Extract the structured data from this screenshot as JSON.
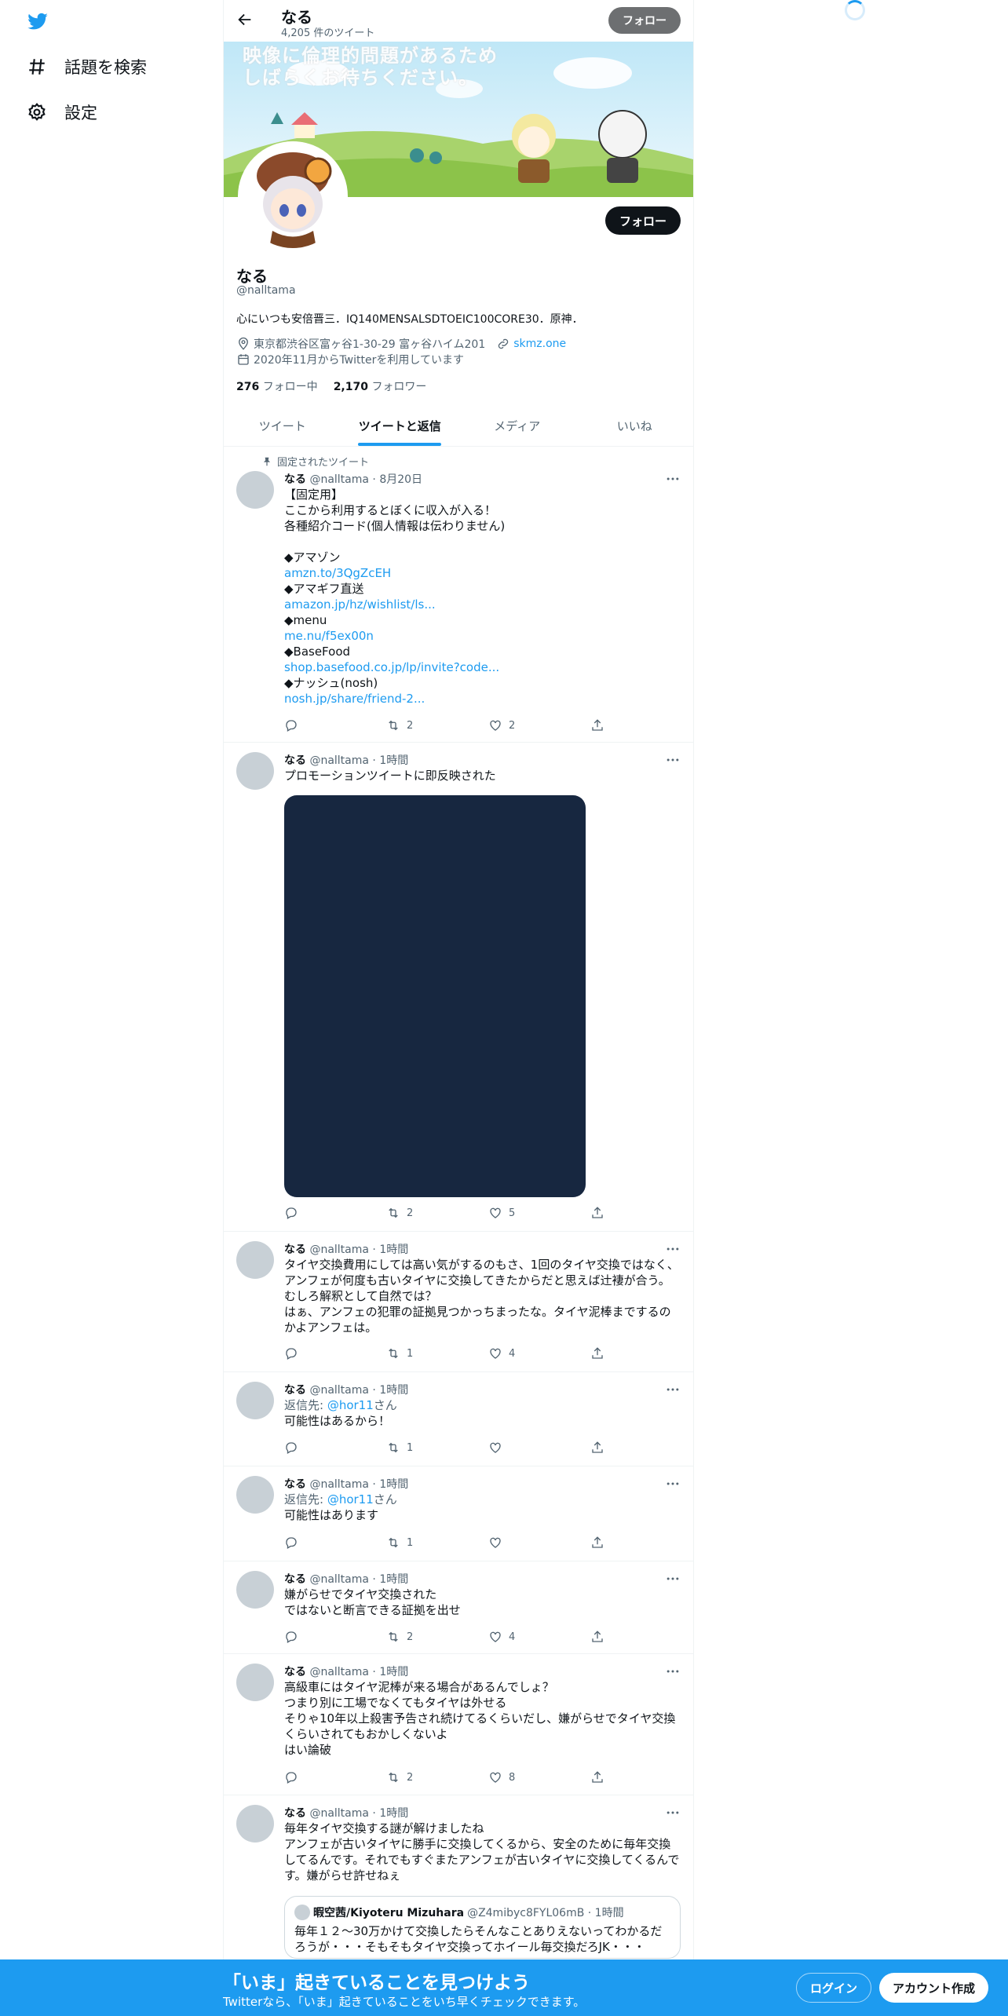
{
  "nav": {
    "explore_label": "話題を検索",
    "settings_label": "設定"
  },
  "topbar": {
    "name": "なる",
    "tweet_count": "4,205 件のツイート",
    "follow_label": "フォロー"
  },
  "banner": {
    "text_line1": "映像に倫理的問題があるため",
    "text_line2": "しばらくお待ちください。"
  },
  "profile": {
    "follow_label": "フォロー",
    "name": "なる",
    "handle": "@nalltama",
    "bio": "心にいつも安倍晋三．IQ140MENSALSDTOEIC100CORE30．原神．",
    "location": "東京都渋谷区富ヶ谷1-30-29 富ヶ谷ハイム201",
    "website": "skmz.one",
    "joined": "2020年11月からTwitterを利用しています",
    "following_count": "276",
    "following_label": "フォロー中",
    "followers_count": "2,170",
    "followers_label": "フォロワー"
  },
  "tabs": [
    {
      "label": "ツイート"
    },
    {
      "label": "ツイートと返信"
    },
    {
      "label": "メディア"
    },
    {
      "label": "いいね"
    }
  ],
  "tweets": [
    {
      "pinned_label": "固定されたツイート",
      "name": "なる",
      "meta": "@nalltama · 8月20日",
      "text_lines": [
        "【固定用】",
        "ここから利用するとぼくに収入が入る！",
        "各種紹介コード(個人情報は伝わりません)",
        "",
        "◆アマゾン"
      ],
      "link1": "amzn.to/3QgZcEH",
      "line2": "◆アマギフ直送",
      "link2": "amazon.jp/hz/wishlist/ls...",
      "line3": "◆menu",
      "link3": "me.nu/f5ex00n",
      "line4": "◆BaseFood",
      "link4": "shop.basefood.co.jp/lp/invite?code...",
      "line5": "◆ナッシュ(nosh)",
      "link5": "nosh.jp/share/friend-2...",
      "retweets": "2",
      "likes": "2"
    },
    {
      "name": "なる",
      "meta": "@nalltama · 1時間",
      "text": "プロモーションツイートに即反映された",
      "retweets": "2",
      "likes": "5"
    },
    {
      "name": "なる",
      "meta": "@nalltama · 1時間",
      "text": "タイヤ交換費用にしては高い気がするのもさ、1回のタイヤ交換ではなく、アンフェが何度も古いタイヤに交換してきたからだと思えば辻褄が合う。むしろ解釈として自然では？\nはぁ、アンフェの犯罪の証拠見つかっちまったな。タイヤ泥棒までするのかよアンフェは。",
      "retweets": "1",
      "likes": "4"
    },
    {
      "name": "なる",
      "meta": "@nalltama · 1時間",
      "reply_prefix": "返信先: ",
      "reply_handle": "@hor11",
      "reply_suffix": "さん",
      "text": "可能性はあるから！",
      "retweets": "1",
      "likes": ""
    },
    {
      "name": "なる",
      "meta": "@nalltama · 1時間",
      "reply_prefix": "返信先: ",
      "reply_handle": "@hor11",
      "reply_suffix": "さん",
      "text": "可能性はあります",
      "retweets": "1",
      "likes": ""
    },
    {
      "name": "なる",
      "meta": "@nalltama · 1時間",
      "text": "嫌がらせでタイヤ交換された\nではないと断言できる証拠を出せ",
      "retweets": "2",
      "likes": "4"
    },
    {
      "name": "なる",
      "meta": "@nalltama · 1時間",
      "text": "高級車にはタイヤ泥棒が来る場合があるんでしょ？\nつまり別に工場でなくてもタイヤは外せる\nそりゃ10年以上殺害予告され続けてるくらいだし、嫌がらせでタイヤ交換くらいされてもおかしくないよ\nはい論破",
      "retweets": "2",
      "likes": "8"
    },
    {
      "name": "なる",
      "meta": "@nalltama · 1時間",
      "text": "毎年タイヤ交換する謎が解けましたね\nアンフェが古いタイヤに勝手に交換してくるから、安全のために毎年交換してるんです。それでもすぐまたアンフェが古いタイヤに交換してくるんです。嫌がらせ許せねぇ",
      "quote_name": "暇空茜/Kiyoteru Mizuhara",
      "quote_meta": "@Z4mibyc8FYL06mB · 1時間",
      "quote_text": "毎年１２～30万かけて交換したらそんなことありえないってわかるだろうが・・・そもそもタイヤ交換ってホイール毎交換だろJK・・・"
    }
  ],
  "bottombar": {
    "title": "「いま」起きていることを見つけよう",
    "subtitle": "Twitterなら、「いま」起きていることをいち早くチェックできます。",
    "login_label": "ログイン",
    "signup_label": "アカウント作成"
  },
  "colors": {
    "accent": "#1d9bf0",
    "text": "#0f1419",
    "muted": "#536471"
  }
}
